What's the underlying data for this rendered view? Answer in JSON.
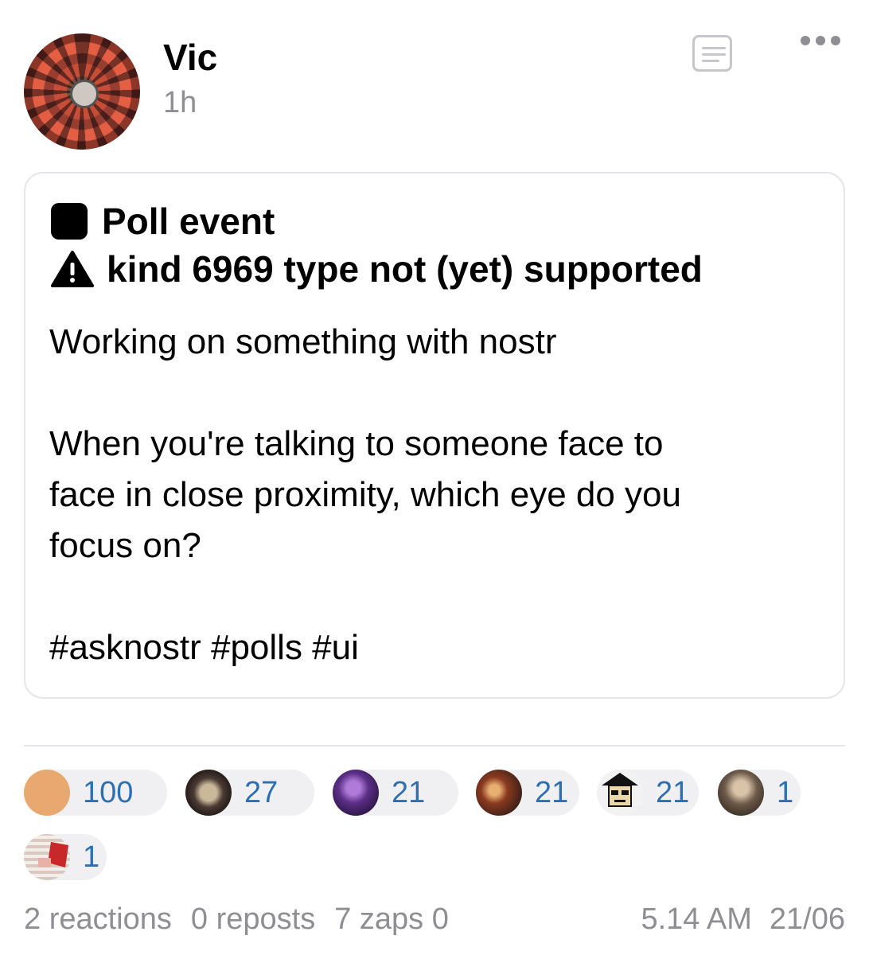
{
  "author": {
    "name": "Vic",
    "time": "1h"
  },
  "card": {
    "poll_title": "Poll event",
    "warning": "kind 6969 type not (yet) supported",
    "text_lines": [
      "Working on something with nostr",
      "",
      "When you're talking to someone face to",
      "face in close proximity, which eye do you",
      "focus on?",
      "",
      "#asknostr #polls #ui"
    ]
  },
  "zappers": [
    {
      "count": "100",
      "avatar_color": "#e8a870"
    },
    {
      "count": "27",
      "avatar_color": "#4a3a34"
    },
    {
      "count": "21",
      "avatar_color": "#5b2f86"
    },
    {
      "count": "21",
      "avatar_color": "#6a3a28"
    },
    {
      "count": "21",
      "avatar_color": "#f2f2f2"
    },
    {
      "count": "1",
      "avatar_color": "#6d5a4a"
    },
    {
      "count": "1",
      "avatar_color": "#d9c9c0"
    }
  ],
  "stats": {
    "reactions": "2 reactions",
    "reposts": "0 reposts",
    "zaps": "7 zaps 0"
  },
  "timestamp": {
    "time": "5.14 AM",
    "date": "21/06"
  },
  "colors": {
    "link_blue": "#2e6fb3",
    "muted_gray": "#8e8e93",
    "pill_bg": "#f0f0f2"
  }
}
